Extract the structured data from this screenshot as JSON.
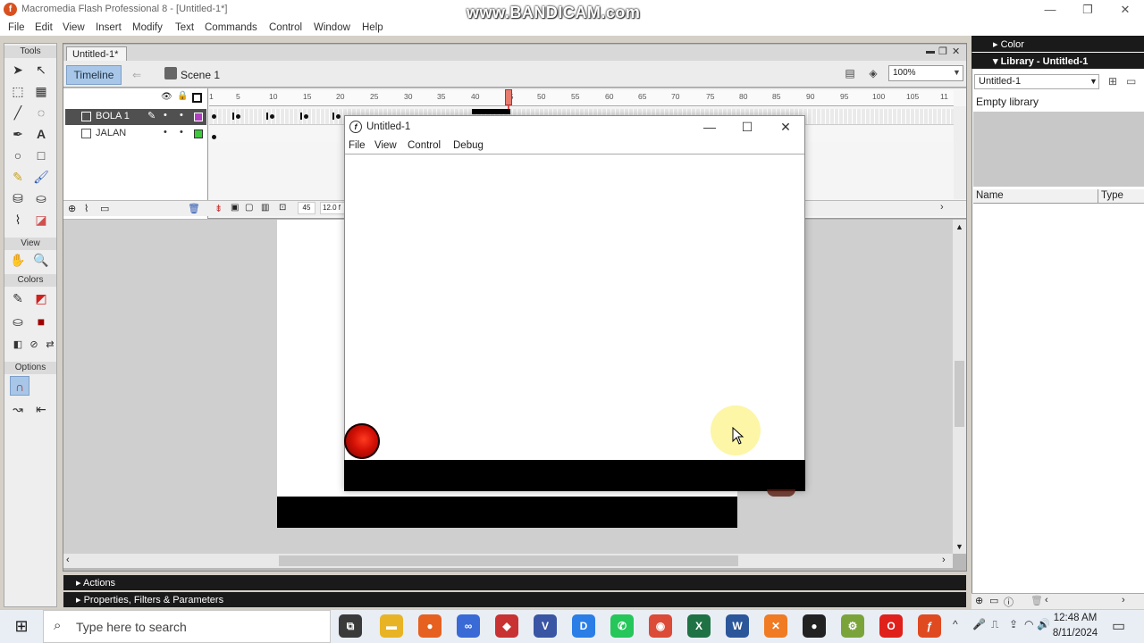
{
  "window": {
    "title": "Macromedia Flash Professional 8 - [Untitled-1*]",
    "watermark": "www.BANDICAM.com",
    "controls": [
      "—",
      "❐",
      "✕"
    ]
  },
  "menu": [
    "File",
    "Edit",
    "View",
    "Insert",
    "Modify",
    "Text",
    "Commands",
    "Control",
    "Window",
    "Help"
  ],
  "tools": {
    "header": "Tools",
    "view_header": "View",
    "colors_header": "Colors",
    "options_header": "Options"
  },
  "document": {
    "tab": "Untitled-1*",
    "timeline_button": "Timeline",
    "scene": "Scene 1",
    "zoom": "100%",
    "layers": [
      {
        "name": "BOLA 1",
        "selected": true,
        "color": "#b040c0"
      },
      {
        "name": "JALAN",
        "selected": false,
        "color": "#3ec83e"
      }
    ],
    "ruler_ticks": [
      "1",
      "5",
      "10",
      "15",
      "20",
      "25",
      "30",
      "35",
      "40",
      "45",
      "50",
      "55",
      "60",
      "65",
      "70",
      "75",
      "80",
      "85",
      "90",
      "95",
      "100",
      "105",
      "11"
    ],
    "current_frame": "45",
    "frame_rate": "12.0 f"
  },
  "panels": {
    "actions": "Actions",
    "properties": "Properties, Filters & Parameters",
    "color": "Color",
    "library": "Library - Untitled-1",
    "library_select": "Untitled-1",
    "library_empty": "Empty library",
    "library_cols": {
      "name": "Name",
      "type": "Type"
    }
  },
  "player": {
    "title": "Untitled-1",
    "icon": "f",
    "menu": [
      "File",
      "View",
      "Control",
      "Debug"
    ],
    "controls": [
      "—",
      "☐",
      "✕"
    ]
  },
  "taskbar": {
    "search_placeholder": "Type here to search",
    "time": "12:48 AM",
    "date": "8/11/2024",
    "apps": [
      {
        "name": "task-view",
        "glyph": "⧉",
        "color": "#3a3a3a"
      },
      {
        "name": "file-explorer",
        "glyph": "▬",
        "color": "#e8b426"
      },
      {
        "name": "firefox",
        "glyph": "●",
        "color": "#e66020"
      },
      {
        "name": "infinity-app",
        "glyph": "∞",
        "color": "#3a6ad6"
      },
      {
        "name": "red-app",
        "glyph": "◆",
        "color": "#c83232"
      },
      {
        "name": "visio",
        "glyph": "V",
        "color": "#3955a3"
      },
      {
        "name": "blue-app",
        "glyph": "D",
        "color": "#2a7ee6"
      },
      {
        "name": "whatsapp",
        "glyph": "✆",
        "color": "#25c65a"
      },
      {
        "name": "chrome",
        "glyph": "◉",
        "color": "#dc4a38"
      },
      {
        "name": "excel",
        "glyph": "X",
        "color": "#1f7244"
      },
      {
        "name": "word",
        "glyph": "W",
        "color": "#2b579a"
      },
      {
        "name": "xampp",
        "glyph": "✕",
        "color": "#f07b22"
      },
      {
        "name": "recorder",
        "glyph": "●",
        "color": "#222222"
      },
      {
        "name": "gear-app",
        "glyph": "⚙",
        "color": "#7aa43a"
      },
      {
        "name": "opera",
        "glyph": "O",
        "color": "#e0201b"
      },
      {
        "name": "flash",
        "glyph": "ƒ",
        "color": "#e04a20"
      }
    ],
    "tray_icons": [
      "^",
      "🎤",
      "⎍",
      "⇪",
      "◠",
      "🔊"
    ]
  }
}
